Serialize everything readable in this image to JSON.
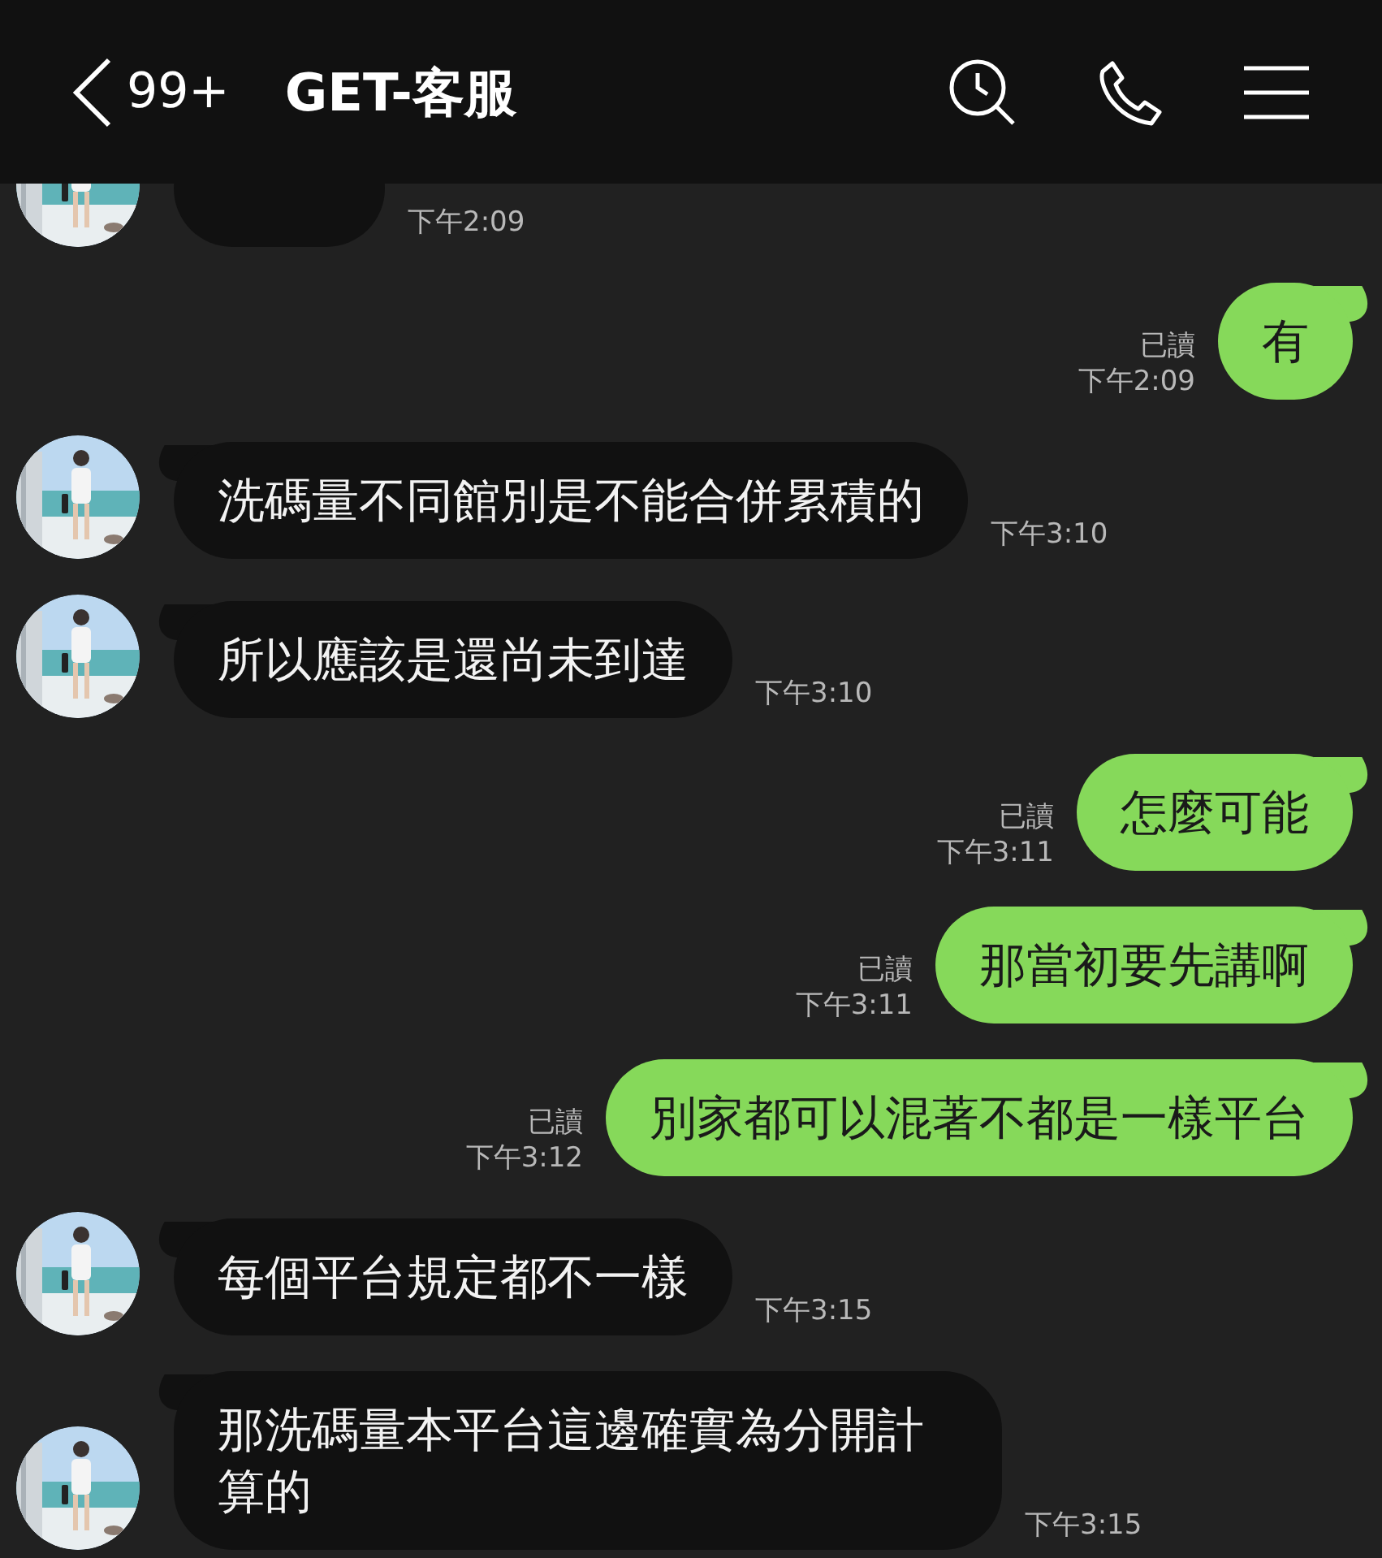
{
  "header": {
    "back_count": "99+",
    "title": "GET-客服"
  },
  "messages": [
    {
      "kind": "incoming",
      "time": "下午2:09"
    },
    {
      "kind": "outgoing",
      "text": "有",
      "read": "已讀",
      "time": "下午2:09"
    },
    {
      "kind": "incoming",
      "text": "洗碼量不同館別是不能合併累積的",
      "time": "下午3:10"
    },
    {
      "kind": "incoming",
      "text": "所以應該是還尚未到達",
      "time": "下午3:10"
    },
    {
      "kind": "outgoing",
      "text": "怎麼可能",
      "read": "已讀",
      "time": "下午3:11"
    },
    {
      "kind": "outgoing",
      "text": "那當初要先講啊",
      "read": "已讀",
      "time": "下午3:11"
    },
    {
      "kind": "outgoing",
      "text": "別家都可以混著不都是一樣平台",
      "read": "已讀",
      "time": "下午3:12"
    },
    {
      "kind": "incoming",
      "text": "每個平台規定都不一樣",
      "time": "下午3:15"
    },
    {
      "kind": "incoming",
      "text": "那洗碼量本平台這邊確實為分開計算的",
      "time": "下午3:15"
    }
  ]
}
